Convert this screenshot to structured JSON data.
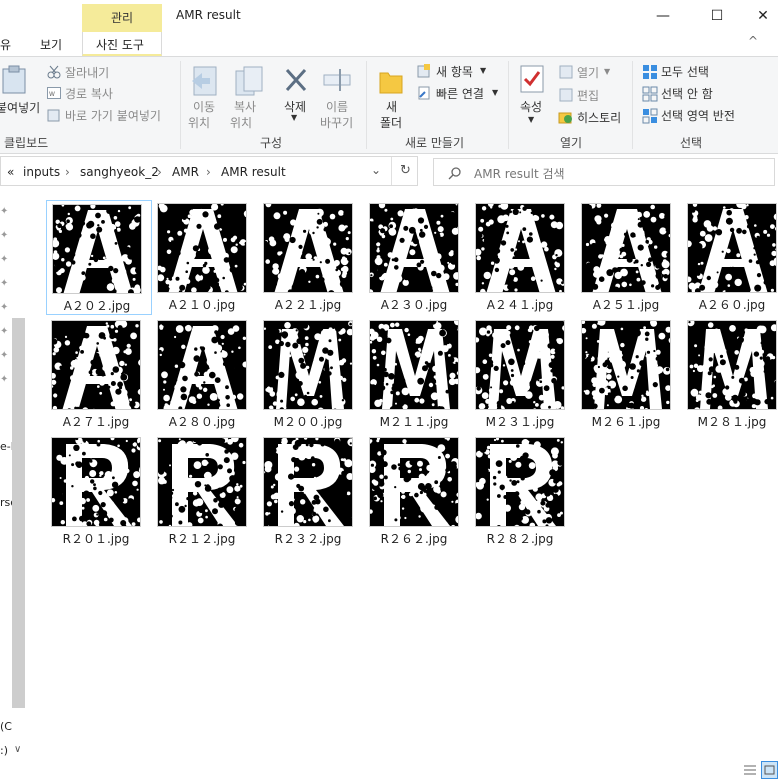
{
  "titlebar": {
    "context_tab": "관리",
    "window_title": "AMR result",
    "minimize": "—",
    "maximize": "☐",
    "close": "✕"
  },
  "tabs": {
    "share_partial": "유",
    "view": "보기",
    "picture_tools": "사진 도구",
    "collapse": "^",
    "help": "?"
  },
  "ribbon": {
    "clipboard": {
      "paste_partial": "붙여넣기",
      "cut": "잘라내기",
      "copy_path": "경로 복사",
      "paste_shortcut": "바로 가기 붙여넣기",
      "group": "클립보드"
    },
    "organize": {
      "move_line1": "이동",
      "move_line2": "위치",
      "copy_line1": "복사",
      "copy_line2": "위치",
      "delete": "삭제",
      "rename_line1": "이름",
      "rename_line2": "바꾸기",
      "group": "구성"
    },
    "new": {
      "folder_line1": "새",
      "folder_line2": "폴더",
      "new_item": "새 항목",
      "easy_access": "빠른 연결",
      "group": "새로 만들기"
    },
    "open": {
      "properties": "속성",
      "open": "열기",
      "edit": "편집",
      "history": "히스토리",
      "group": "열기"
    },
    "select": {
      "select_all": "모두 선택",
      "select_none": "선택 안 함",
      "invert": "선택 영역 반전",
      "group": "선택"
    }
  },
  "address": {
    "overflow": "«",
    "crumbs": [
      "inputs",
      "sanghyeok_2",
      "AMR",
      "AMR result"
    ],
    "sep": "›",
    "search_placeholder": "AMR result 검색"
  },
  "navpane": {
    "item_partial_1": "e-l",
    "item_partial_2": "rsc",
    "item_partial_3": "(C",
    "item_partial_4": ":)"
  },
  "files": [
    {
      "name": "A２０２.jpg",
      "letter": "A"
    },
    {
      "name": "A２１０.jpg",
      "letter": "A"
    },
    {
      "name": "A２２１.jpg",
      "letter": "A"
    },
    {
      "name": "A２３０.jpg",
      "letter": "A"
    },
    {
      "name": "A２４１.jpg",
      "letter": "A"
    },
    {
      "name": "A２５１.jpg",
      "letter": "A"
    },
    {
      "name": "A２６０.jpg",
      "letter": "A"
    },
    {
      "name": "A２７１.jpg",
      "letter": "A"
    },
    {
      "name": "A２８０.jpg",
      "letter": "A"
    },
    {
      "name": "M２００.jpg",
      "letter": "M"
    },
    {
      "name": "M２１１.jpg",
      "letter": "M"
    },
    {
      "name": "M２３１.jpg",
      "letter": "M"
    },
    {
      "name": "M２６１.jpg",
      "letter": "M"
    },
    {
      "name": "M２８１.jpg",
      "letter": "M"
    },
    {
      "name": "R２０１.jpg",
      "letter": "R"
    },
    {
      "name": "R２１２.jpg",
      "letter": "R"
    },
    {
      "name": "R２３２.jpg",
      "letter": "R"
    },
    {
      "name": "R２６２.jpg",
      "letter": "R"
    },
    {
      "name": "R２８２.jpg",
      "letter": "R"
    }
  ],
  "colors": {
    "context_tab": "#f5eb9a",
    "selection_border": "#99d1ff",
    "ribbon_bg": "#f5f6f7"
  }
}
